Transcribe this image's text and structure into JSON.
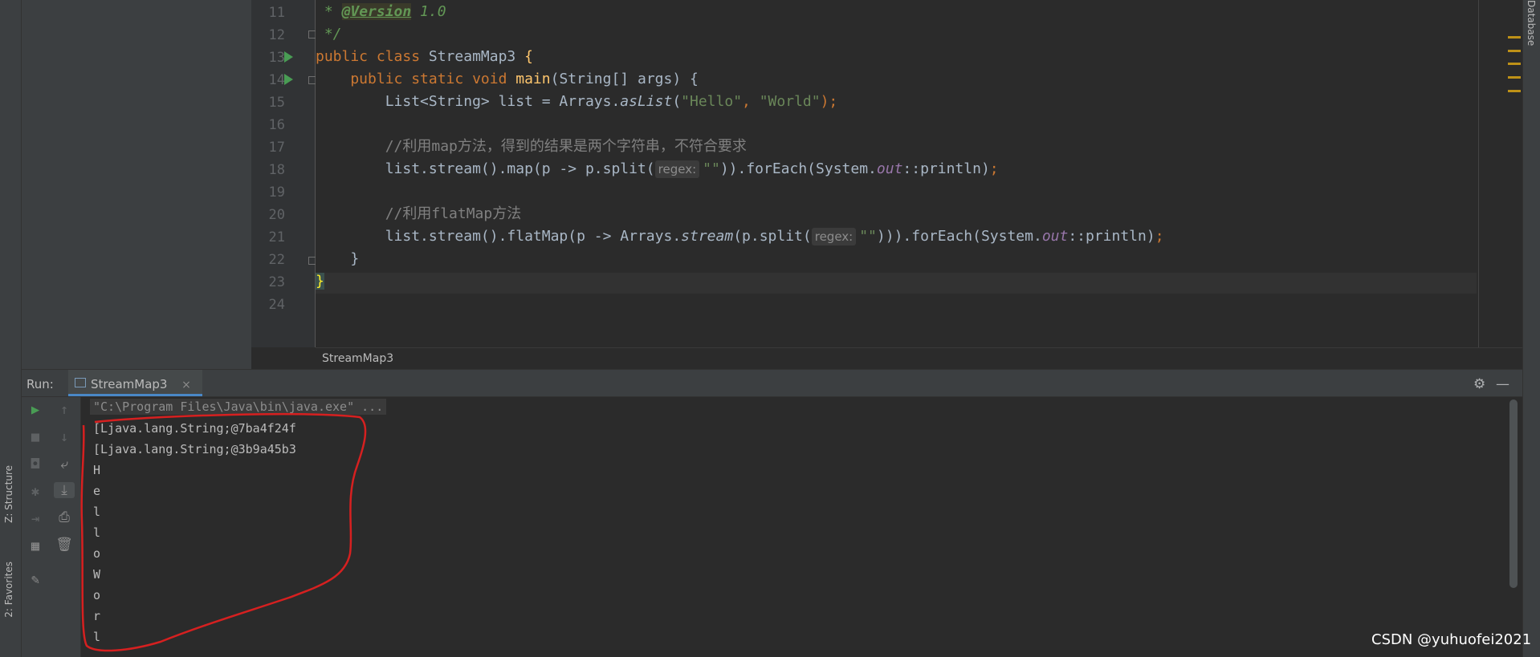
{
  "editor": {
    "line_numbers": [
      "11",
      "12",
      "13",
      "14",
      "15",
      "16",
      "17",
      "18",
      "19",
      "20",
      "21",
      "22",
      "23",
      "24"
    ],
    "lines": {
      "l11_star": " * ",
      "l11_tag": "@Version",
      "l11_rest": " 1.0",
      "l12": " */",
      "l13_kw": "public class",
      "l13_name": " StreamMap3 ",
      "l13_brace": "{",
      "l14_kw": "    public static void",
      "l14_fn": " main",
      "l14_rest": "(String[] args) {",
      "l15_a": "        List<String> list = Arrays.",
      "l15_b": "asList",
      "l15_c": "(",
      "l15_s1": "\"Hello\"",
      "l15_d": ", ",
      "l15_s2": "\"World\"",
      "l15_e": ");",
      "l17": "        //利用map方法，得到的结果是两个字符串，不符合要求",
      "l18_a": "        list.stream().map(p -> p.split(",
      "l18_hint": "regex:",
      "l18_s": "\"\"",
      "l18_b": ")).forEach(System.",
      "l18_field": "out",
      "l18_c": "::println)",
      "l18_semi": ";",
      "l20": "        //利用flatMap方法",
      "l21_a": "        list.stream().flatMap(p -> Arrays.",
      "l21_it": "stream",
      "l21_b": "(p.split(",
      "l21_hint": "regex:",
      "l21_s": "\"\"",
      "l21_c": "))).forEach(System.",
      "l21_field": "out",
      "l21_d": "::println)",
      "l21_semi": ";",
      "l22": "    }",
      "l23": "}"
    },
    "breadcrumb": "StreamMap3"
  },
  "left_strip": {
    "structure_label": "Z: Structure",
    "favorites_label": "2: Favorites"
  },
  "right_strip": {
    "label": "Database"
  },
  "run_window": {
    "label": "Run:",
    "tab_label": "StreamMap3",
    "tab_close": "×",
    "gear_icon": "⚙",
    "minimize_icon": "—"
  },
  "console": {
    "command": "\"C:\\Program Files\\Java\\bin\\java.exe\" ...",
    "output": [
      "[Ljava.lang.String;@7ba4f24f",
      "[Ljava.lang.String;@3b9a45b3",
      "H",
      "e",
      "l",
      "l",
      "o",
      "W",
      "o",
      "r",
      "l"
    ]
  },
  "watermark": "CSDN @yuhuofei2021",
  "colors": {
    "keyword": "#cc7832",
    "string": "#6a8759",
    "function": "#ffc66d",
    "comment": "#808080",
    "annotation_red": "#d62020"
  }
}
